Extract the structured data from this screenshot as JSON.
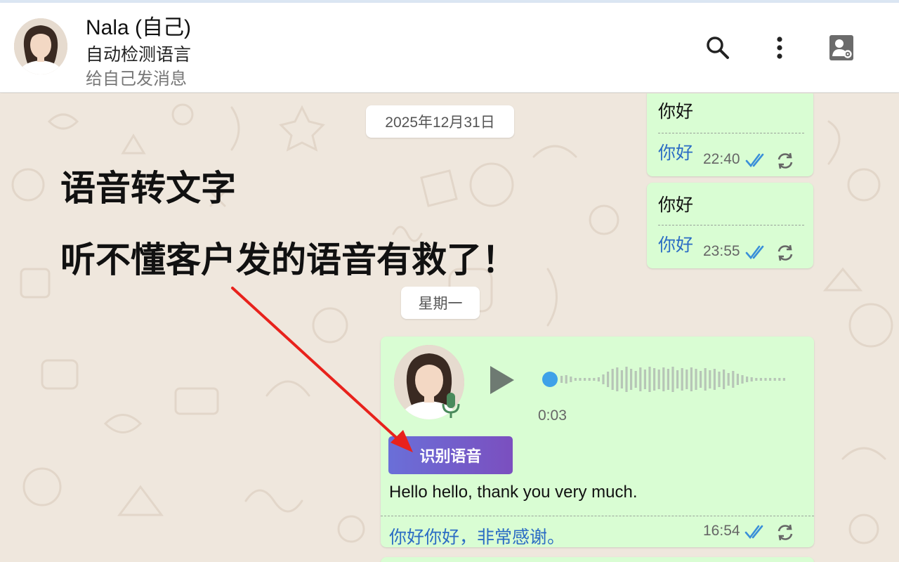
{
  "header": {
    "contact_name": "Nala (自己)",
    "subtitle_language": "自动检测语言",
    "subtitle_hint": "给自己发消息",
    "icons": [
      "search-icon",
      "more-vert-icon",
      "contact-settings-icon"
    ]
  },
  "overlay": {
    "title_line1": "语音转文字",
    "title_line2": "听不懂客户发的语音有救了！"
  },
  "chat": {
    "date_chip_1": "2025年12月31日",
    "date_chip_2": "星期一",
    "messages": [
      {
        "text": "你好",
        "translation": "你好",
        "time": "22:40"
      },
      {
        "text": "你好",
        "translation": "你好",
        "time": "23:55"
      }
    ],
    "voice_message": {
      "duration": "0:03",
      "recognize_button": "识别语音",
      "transcript": "Hello hello, thank you very much.",
      "translation": "你好你好，非常感谢。",
      "time": "16:54"
    }
  },
  "colors": {
    "bubble_out": "#d9fdd3",
    "translation_text": "#2b6cc4",
    "read_tick": "#3a8fd9",
    "chat_background": "#efe7dd",
    "annotation_arrow": "#e8221c"
  }
}
